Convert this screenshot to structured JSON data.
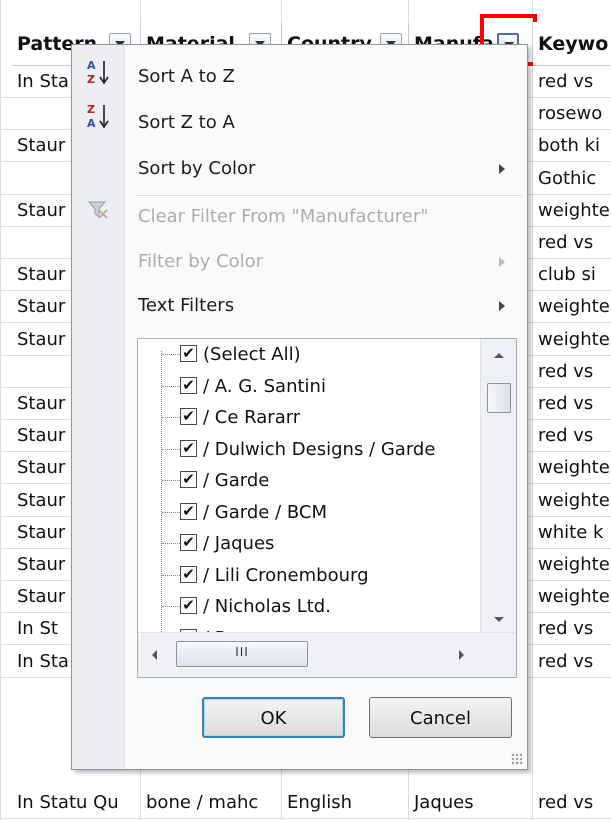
{
  "headers": [
    {
      "label": "Pattern",
      "has_button": true
    },
    {
      "label": "Material",
      "has_button": true
    },
    {
      "label": "Country",
      "has_button": true
    },
    {
      "label": "Manufa",
      "has_button": true,
      "active": true
    },
    {
      "label": "Keywo",
      "has_button": false
    }
  ],
  "rows": [
    {
      "col0": "In Sta",
      "col4": "red vs"
    },
    {
      "col0": "",
      "col4": "rosewo"
    },
    {
      "col0": "Staur",
      "col4": "both ki"
    },
    {
      "col0": "",
      "col4": "Gothic"
    },
    {
      "col0": "Staur",
      "col4": "weighte"
    },
    {
      "col0": "",
      "col4": "red vs"
    },
    {
      "col0": "Staur",
      "col4": "club si"
    },
    {
      "col0": "Staur",
      "col4": "weighte"
    },
    {
      "col0": "Staur",
      "col4": "weighte"
    },
    {
      "col0": "",
      "col4": "red vs"
    },
    {
      "col0": "Staur",
      "col4": "red vs"
    },
    {
      "col0": "Staur",
      "col4": "red vs"
    },
    {
      "col0": "Staur",
      "col4": "weighte"
    },
    {
      "col0": "Staur",
      "col4": "weighte"
    },
    {
      "col0": "Staur",
      "col4": "white k"
    },
    {
      "col0": "Staur",
      "col4": "weighte"
    },
    {
      "col0": "Staur",
      "col4": "weighte"
    },
    {
      "col0": "In St",
      "col4": "red vs"
    },
    {
      "col0": "In Sta",
      "col4": "red vs"
    }
  ],
  "last_row": {
    "pattern": "In Statu Qu",
    "material": "bone / mahc",
    "country": "English",
    "manufacturer": "Jaques",
    "keyword": "red vs"
  },
  "menu": {
    "sort_az": "Sort A to Z",
    "sort_za": "Sort Z to A",
    "sort_by_color": "Sort by Color",
    "clear_filter": "Clear Filter From \"Manufacturer\"",
    "filter_by_color": "Filter by Color",
    "text_filters": "Text Filters"
  },
  "list": {
    "items": [
      {
        "label": "(Select All)",
        "checked": true
      },
      {
        "label": "/ A. G. Santini",
        "checked": true
      },
      {
        "label": "/ Ce Rararr",
        "checked": true
      },
      {
        "label": "/ Dulwich Designs / Garde",
        "checked": true
      },
      {
        "label": "/ Garde",
        "checked": true
      },
      {
        "label": "/ Garde / BCM",
        "checked": true
      },
      {
        "label": "/ Jaques",
        "checked": true
      },
      {
        "label": "/ Lili Cronembourg",
        "checked": true
      },
      {
        "label": "/ Nicholas Ltd.",
        "checked": true
      },
      {
        "label": "/ P",
        "checked": true
      }
    ],
    "hscroll_grip": "III"
  },
  "buttons": {
    "ok": "OK",
    "cancel": "Cancel"
  },
  "icons": {
    "sort_az": "sort-ascending-icon",
    "sort_za": "sort-descending-icon",
    "clear_filter": "clear-filter-icon",
    "check": "checkmark-icon"
  },
  "colors": {
    "highlight": "#ff0000",
    "ok_border": "#3c7fb1"
  }
}
